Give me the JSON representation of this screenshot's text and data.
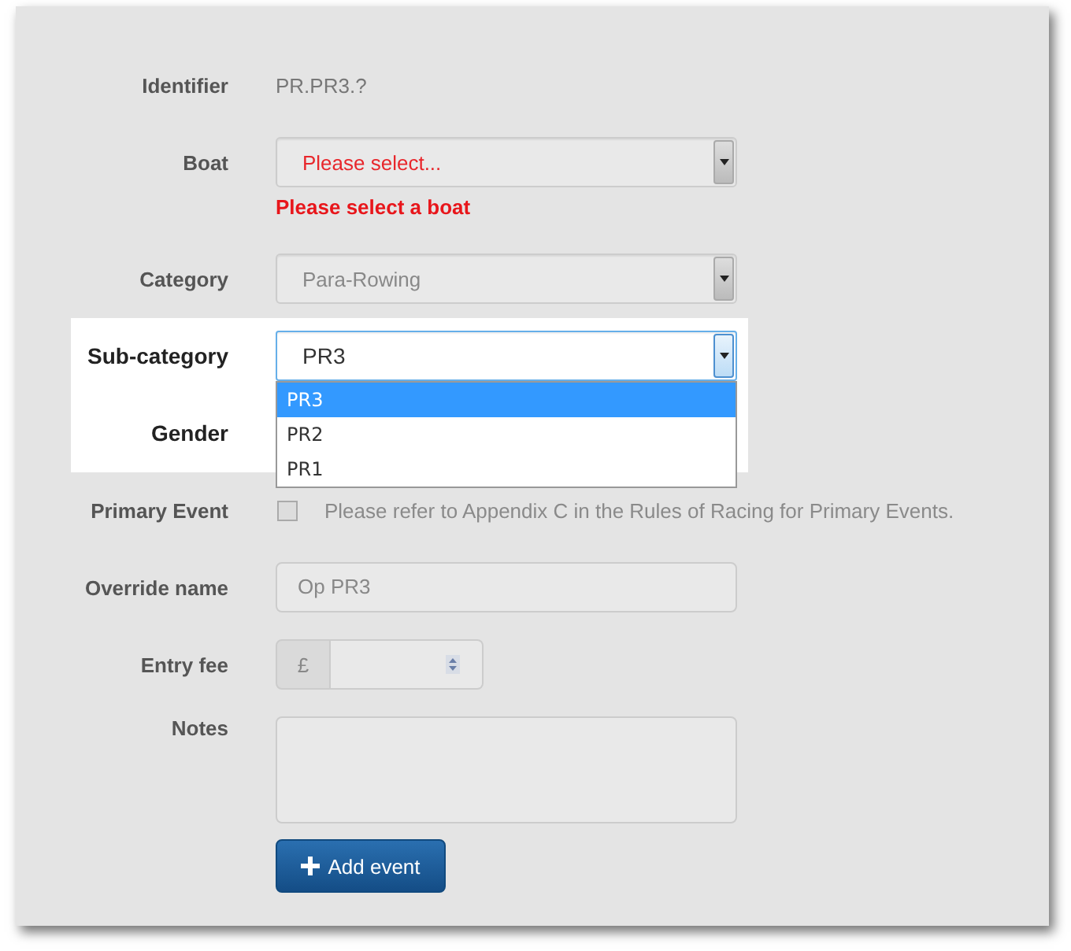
{
  "fields": [
    {
      "kind": "static",
      "label": "Identifier",
      "value": "PR.PR3.?"
    },
    {
      "kind": "select",
      "label": "Boat",
      "value": "Please select...",
      "invalid": true,
      "error": "Please select a boat"
    },
    {
      "kind": "select",
      "label": "Category",
      "value": "Para-Rowing"
    },
    {
      "kind": "select",
      "label": "Sub-category",
      "value": "PR3",
      "highlighted": true,
      "expanded": true,
      "options": [
        {
          "label": "PR3",
          "selected": true
        },
        {
          "label": "PR2",
          "selected": false
        },
        {
          "label": "PR1",
          "selected": false
        }
      ]
    },
    {
      "kind": "covered",
      "label": "Gender",
      "highlighted": true
    },
    {
      "kind": "checkbox",
      "label": "Primary Event",
      "checked": false,
      "note": "Please refer to Appendix C in the Rules of Racing for Primary Events."
    },
    {
      "kind": "input",
      "label": "Override name",
      "value": "Op PR3"
    },
    {
      "kind": "money",
      "label": "Entry fee",
      "prefix": "£"
    },
    {
      "kind": "textarea",
      "label": "Notes"
    }
  ],
  "button": {
    "label": "Add event"
  }
}
